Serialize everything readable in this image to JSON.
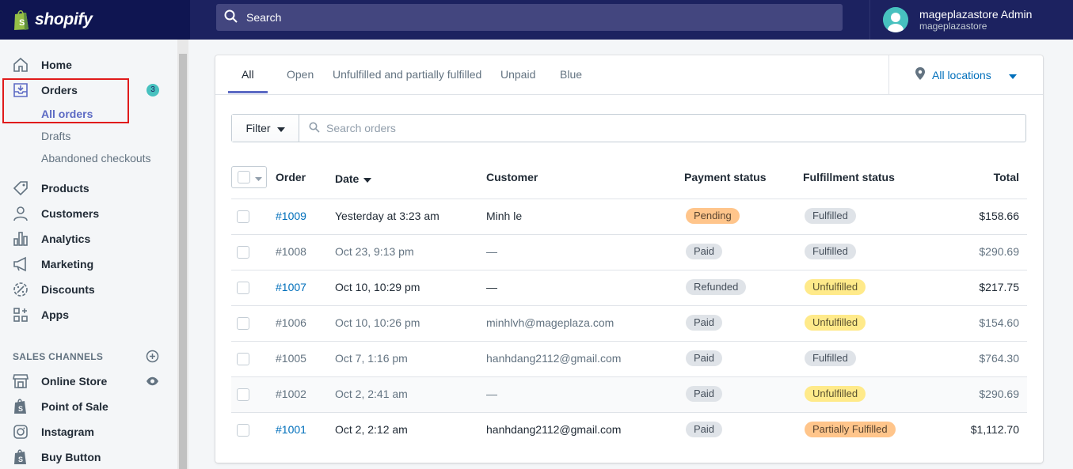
{
  "brand": {
    "name": "shopify"
  },
  "search": {
    "placeholder": "Search"
  },
  "user": {
    "name": "mageplazastore Admin",
    "shop": "mageplazastore"
  },
  "sidebar": {
    "items": [
      {
        "label": "Home",
        "icon": "home-icon"
      },
      {
        "label": "Orders",
        "icon": "orders-icon",
        "badge": "3"
      },
      {
        "label": "Products",
        "icon": "tag-icon"
      },
      {
        "label": "Customers",
        "icon": "person-icon"
      },
      {
        "label": "Analytics",
        "icon": "bar-chart-icon"
      },
      {
        "label": "Marketing",
        "icon": "megaphone-icon"
      },
      {
        "label": "Discounts",
        "icon": "discount-icon"
      },
      {
        "label": "Apps",
        "icon": "apps-icon"
      }
    ],
    "orders_sub": [
      "All orders",
      "Drafts",
      "Abandoned checkouts"
    ],
    "sales_channels_title": "SALES CHANNELS",
    "channels": [
      {
        "label": "Online Store",
        "icon": "store-icon"
      },
      {
        "label": "Point of Sale",
        "icon": "shopify-bag-icon"
      },
      {
        "label": "Instagram",
        "icon": "instagram-icon"
      },
      {
        "label": "Buy Button",
        "icon": "shopify-bag-icon"
      }
    ]
  },
  "tabs": [
    "All",
    "Open",
    "Unfulfilled and partially fulfilled",
    "Unpaid",
    "Blue"
  ],
  "locations": {
    "label": "All locations"
  },
  "filter": {
    "label": "Filter",
    "placeholder": "Search orders"
  },
  "table": {
    "headers": {
      "order": "Order",
      "date": "Date",
      "customer": "Customer",
      "payment": "Payment status",
      "fulfillment": "Fulfillment status",
      "total": "Total"
    },
    "rows": [
      {
        "order": "#1009",
        "date": "Yesterday at 3:23 am",
        "customer": "Minh le",
        "payment": "Pending",
        "fulfillment": "Fulfilled",
        "total": "$158.66"
      },
      {
        "order": "#1008",
        "date": "Oct 23, 9:13 pm",
        "customer": "—",
        "payment": "Paid",
        "fulfillment": "Fulfilled",
        "total": "$290.69"
      },
      {
        "order": "#1007",
        "date": "Oct 10, 10:29 pm",
        "customer": "—",
        "payment": "Refunded",
        "fulfillment": "Unfulfilled",
        "total": "$217.75"
      },
      {
        "order": "#1006",
        "date": "Oct 10, 10:26 pm",
        "customer": "minhlvh@mageplaza.com",
        "payment": "Paid",
        "fulfillment": "Unfulfilled",
        "total": "$154.60"
      },
      {
        "order": "#1005",
        "date": "Oct 7, 1:16 pm",
        "customer": "hanhdang2112@gmail.com",
        "payment": "Paid",
        "fulfillment": "Fulfilled",
        "total": "$764.30"
      },
      {
        "order": "#1002",
        "date": "Oct 2, 2:41 am",
        "customer": "—",
        "payment": "Paid",
        "fulfillment": "Unfulfilled",
        "total": "$290.69"
      },
      {
        "order": "#1001",
        "date": "Oct 2, 2:12 am",
        "customer": "hanhdang2112@gmail.com",
        "payment": "Paid",
        "fulfillment": "Partially Fulfilled",
        "total": "$1,112.70"
      }
    ]
  },
  "colors": {
    "topbar": "#1c2260",
    "accent": "#5c6ac4",
    "link": "#006fbb",
    "highlight": "#e01b1b"
  }
}
